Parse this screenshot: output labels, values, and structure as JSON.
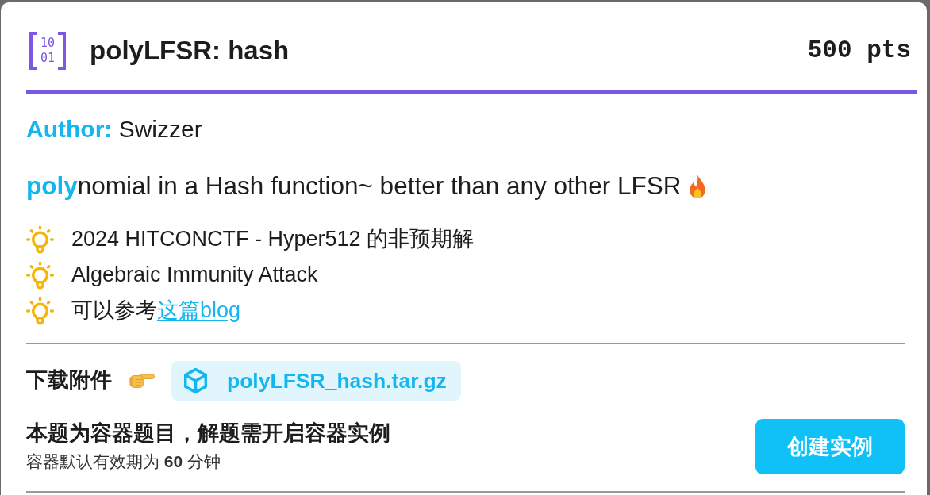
{
  "header": {
    "logo_digits": [
      "10",
      "01"
    ],
    "title": "polyLFSR: hash",
    "points": "500 pts"
  },
  "author": "**Author:** Swizzer",
  "description": "**poly**nomial in a Hash function~ better than any other LFSR",
  "hints": [
    {
      "kind": "text",
      "text": "2024 HITCONCTF - Hyper512 的非预期解"
    },
    {
      "kind": "text",
      "text": "Algebraic Immunity Attack"
    },
    {
      "kind": "link",
      "text": "可以参考",
      "link": "这篇blog"
    }
  ],
  "attachment": {
    "label": "下载附件",
    "file": "polyLFSR_hash.tar.gz"
  },
  "container": {
    "title": "本题为容器题目，解题需开启容器实例",
    "note": "容器默认有效期为 **60** 分钟",
    "button": "创建实例"
  }
}
